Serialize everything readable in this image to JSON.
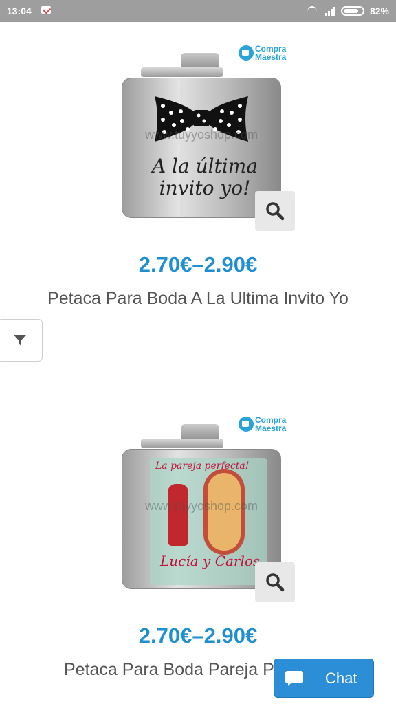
{
  "status_bar": {
    "time": "13:04",
    "battery": "82%"
  },
  "brand": {
    "line1": "Compra",
    "line2": "Maestra"
  },
  "products": [
    {
      "watermark": "www.tuyyoshop.com",
      "flask_text": "A la última invito yo!",
      "price": "2.70€–2.90€",
      "title": "Petaca Para Boda A La Ultima Invito Yo"
    },
    {
      "watermark": "www.tuyyoshop.com",
      "flask_tagline": "La pareja perfecta!",
      "flask_names": "Lucía y Carlos",
      "price": "2.70€–2.90€",
      "title": "Petaca Para Boda Pareja P"
    }
  ],
  "chat": {
    "label": "Chat"
  },
  "colors": {
    "status_bar": "#9e9e9e",
    "price": "#1f8fd0",
    "chat_button": "#2c8ed6"
  }
}
